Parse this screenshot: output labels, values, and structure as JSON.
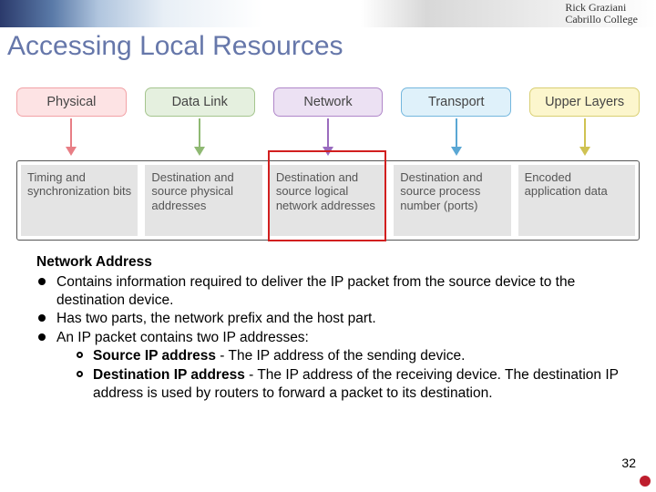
{
  "header": {
    "credit_line1": "Rick Graziani",
    "credit_line2": "Cabrillo College"
  },
  "title": "Accessing Local Resources",
  "layers": [
    {
      "name": "Physical",
      "desc": "Timing and synchronization bits"
    },
    {
      "name": "Data Link",
      "desc": "Destination and source physical addresses"
    },
    {
      "name": "Network",
      "desc": "Destination and source logical network addresses"
    },
    {
      "name": "Transport",
      "desc": "Destination and source process number (ports)"
    },
    {
      "name": "Upper Layers",
      "desc": "Encoded application data"
    }
  ],
  "highlight_index": 2,
  "content": {
    "heading": "Network Address",
    "bullets": [
      "Contains information required to deliver the IP packet from the source device to the destination device.",
      "Has two parts, the network prefix and the host part.",
      "An IP packet contains two IP addresses:"
    ],
    "sub": [
      {
        "lead": "Source IP address",
        "text": " - The IP address of the sending device."
      },
      {
        "lead": "Destination IP address",
        "text": " - The IP address of the receiving device. The destination IP address is used by routers to forward a packet to its destination."
      }
    ]
  },
  "page_number": "32"
}
